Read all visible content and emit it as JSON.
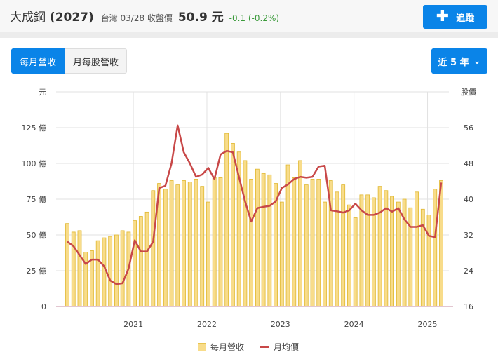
{
  "header": {
    "name": "大成鋼",
    "code": "(2027)",
    "market_date": "台灣 03/28 收盤價",
    "price": "50.9 元",
    "change": "-0.1 (-0.2%)",
    "track_label": "追蹤",
    "track_icon": "plus-icon"
  },
  "tabs": [
    {
      "label": "每月營收",
      "active": true
    },
    {
      "label": "月每股營收",
      "active": false
    }
  ],
  "range": {
    "label": "近 5 年",
    "icon": "chevron-down-icon"
  },
  "colors": {
    "accent": "#0a84e8",
    "bar": "#f8dc8a",
    "bar_border": "#e0b830",
    "line": "#c84848",
    "change": "#3a9a3a"
  },
  "chart_data": {
    "type": "bar+line",
    "left_axis": {
      "unit": "元",
      "ticks": [
        "0",
        "25 億",
        "50 億",
        "75 億",
        "100 億",
        "125 億"
      ],
      "values": [
        0,
        25,
        50,
        75,
        100,
        125
      ],
      "range": [
        0,
        150
      ]
    },
    "right_axis": {
      "unit": "股價",
      "ticks": [
        "16",
        "24",
        "32",
        "40",
        "48",
        "56"
      ],
      "values": [
        16,
        24,
        32,
        40,
        48,
        56
      ],
      "range": [
        16,
        64
      ]
    },
    "x_ticks": [
      {
        "label": "2021",
        "index": 11
      },
      {
        "label": "2022",
        "index": 23
      },
      {
        "label": "2023",
        "index": 35
      },
      {
        "label": "2024",
        "index": 47
      },
      {
        "label": "2025",
        "index": 59
      }
    ],
    "first_month": "2020-02",
    "series": [
      {
        "name": "每月營收",
        "type": "bar",
        "axis": "left",
        "values": [
          58,
          52,
          53,
          38,
          39,
          46,
          48,
          49,
          50,
          53,
          52,
          60,
          63,
          66,
          81,
          86,
          82,
          88,
          85,
          88,
          87,
          89,
          84,
          73,
          90,
          90,
          121,
          114,
          108,
          102,
          89,
          96,
          93,
          92,
          86,
          73,
          99,
          90,
          102,
          85,
          89,
          89,
          73,
          88,
          80,
          85,
          71,
          62,
          78,
          78,
          76,
          84,
          81,
          77,
          73,
          75,
          69,
          80,
          68,
          64,
          82,
          88
        ]
      },
      {
        "name": "月均價",
        "type": "line",
        "axis": "right",
        "values": [
          30.5,
          29.5,
          27.5,
          25.5,
          26.5,
          26.5,
          25,
          21.8,
          21,
          21.2,
          24.5,
          30.8,
          28.3,
          28.3,
          30.5,
          42.5,
          43,
          48,
          56.5,
          50.5,
          48,
          45,
          45.5,
          47,
          44.5,
          50,
          50.8,
          50.5,
          45,
          39.5,
          35,
          38,
          38.3,
          38.5,
          39.5,
          42.5,
          43.3,
          44.5,
          45,
          44.8,
          45,
          47.3,
          47.5,
          37.5,
          37.3,
          37,
          37.5,
          39,
          37.5,
          36.5,
          36.5,
          37,
          38,
          37.2,
          38,
          35.5,
          33.8,
          33.8,
          34.2,
          31.8,
          31.5,
          43.7
        ]
      }
    ]
  }
}
